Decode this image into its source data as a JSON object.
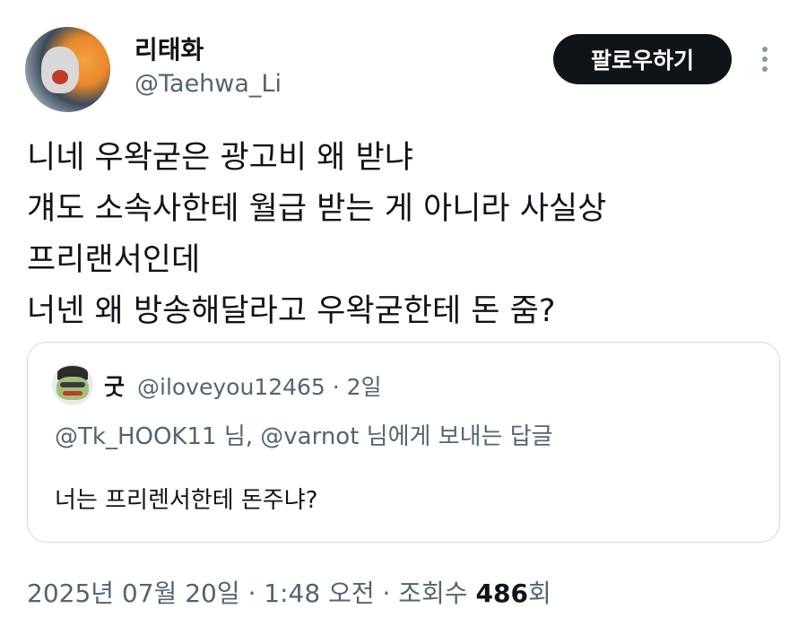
{
  "author": {
    "display_name": "리태화",
    "handle": "@Taehwa_Li"
  },
  "follow_label": "팔로우하기",
  "more_icon": "more-vertical-icon",
  "tweet": {
    "lines": [
      "니네 우왁굳은 광고비 왜 받냐",
      "걔도 소속사한테 월급 받는 게 아니라 사실상",
      "프리랜서인데",
      "너넨 왜 방송해달라고 우왁굳한테 돈 줌?"
    ]
  },
  "quoted": {
    "display_name": "굿",
    "meta": "@iloveyou12465 · 2일",
    "reply_line": "@Tk_HOOK11 님, @varnot 님에게 보내는 답글",
    "text": "너는 프리렌서한테 돈주냐?"
  },
  "footer": {
    "datetime": "2025년 07월 20일 · 1:48 오전 · 조회수 ",
    "views": "486",
    "views_suffix": "회"
  },
  "colors": {
    "text": "#0f1419",
    "secondary": "#536471",
    "border": "#cfd9de",
    "button_bg": "#0f1419"
  }
}
